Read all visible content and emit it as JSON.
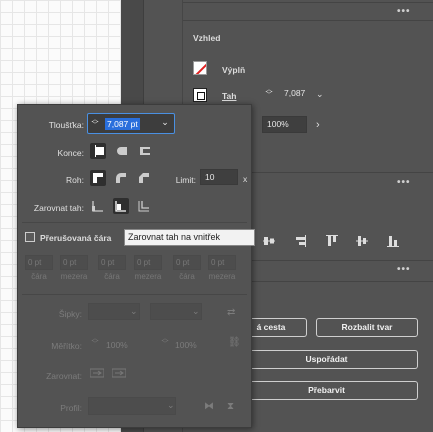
{
  "panel": {
    "appearance_title": "Vzhled",
    "fill_label": "Výplň",
    "stroke_label": "Tah",
    "stroke_value": "7,087",
    "opacity_value": "100%",
    "buttons": {
      "offset_path": "á cesta",
      "expand_shape": "Rozbalit tvar",
      "arrange": "Uspořádat",
      "recolor": "Přebarvit"
    }
  },
  "popup": {
    "weight_label": "Tloušťka:",
    "weight_value": "7,087 pt",
    "caps_label": "Konce:",
    "corner_label": "Roh:",
    "limit_label": "Limit:",
    "limit_value": "10",
    "limit_unit": "x",
    "align_label": "Zarovnat tah:",
    "dashed_label": "Přerušovaná čára",
    "dash_fields": [
      {
        "value": "0 pt",
        "caption": "čára"
      },
      {
        "value": "0 pt",
        "caption": "mezera"
      },
      {
        "value": "0 pt",
        "caption": "čára"
      },
      {
        "value": "0 pt",
        "caption": "mezera"
      },
      {
        "value": "0 pt",
        "caption": "čára"
      },
      {
        "value": "0 pt",
        "caption": "mezera"
      }
    ],
    "arrows_label": "Šipky:",
    "scale_label": "Měřítko:",
    "scale_value_1": "100%",
    "scale_value_2": "100%",
    "align_arrows_label": "Zarovnat:",
    "profile_label": "Profil:"
  },
  "tooltip": "Zarovnat tah na vnitřek",
  "dots": "•••"
}
